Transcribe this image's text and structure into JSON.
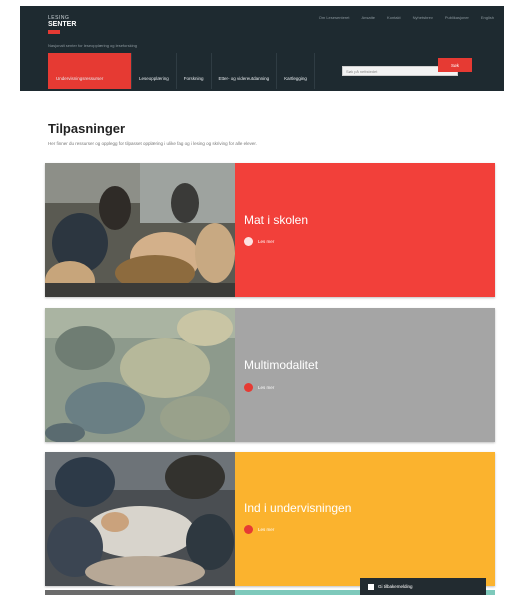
{
  "header": {
    "logo_line1": "LESING",
    "logo_line2": "SENTER",
    "tagline": "Nasjonalt senter for leseopplæring og leseforsking",
    "top_links": [
      "Om Lesesenteret",
      "Ansatte",
      "Kontakt",
      "Nyhetsbrev",
      "Publikasjoner",
      "English"
    ],
    "nav": [
      {
        "label": "Undervisningsressurser",
        "active": true
      },
      {
        "label": "Leseopplæring",
        "active": false
      },
      {
        "label": "Forskning",
        "active": false
      },
      {
        "label": "Etter- og videreutdanning",
        "active": false
      },
      {
        "label": "Kartlegging",
        "active": false
      }
    ],
    "search_placeholder": "Søk på nettstedet",
    "search_button": "Søk"
  },
  "section": {
    "title": "Tilpasninger",
    "description": "Her finner du ressurser og opplegg for tilpasset opplæring i ulike fag og i lesing og skriving for alle elever."
  },
  "cards": [
    {
      "title": "Mat i skolen",
      "more": "Les mer",
      "color": "#f2403a"
    },
    {
      "title": "Multimodalitet",
      "more": "Les mer",
      "color": "#a5a5a5"
    },
    {
      "title": "Ind i undervisningen",
      "more": "Les mer",
      "color": "#fbb32e"
    }
  ],
  "float_button": {
    "label": "Gi tilbakemelding"
  },
  "colors": {
    "header_bg": "#1e2a30",
    "accent": "#e63a33"
  }
}
